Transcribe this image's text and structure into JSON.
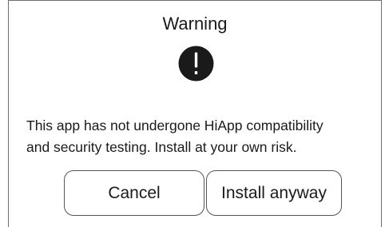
{
  "dialog": {
    "title": "Warning",
    "icon": "exclamation-circle-icon",
    "message_line1": "This app has not undergone HiApp compatibility",
    "message_line2": "and security testing. Install at your own risk.",
    "cancel_label": "Cancel",
    "install_label": "Install anyway"
  },
  "colors": {
    "icon_fill": "#1a1a1a",
    "icon_glyph": "#ffffff",
    "border": "#6f6f6f"
  }
}
